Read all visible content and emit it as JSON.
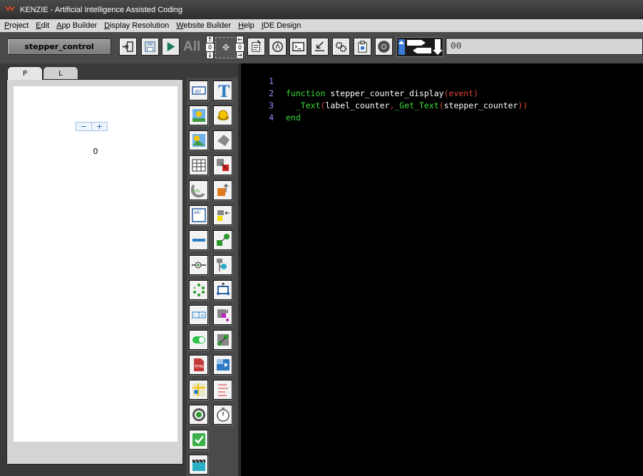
{
  "window": {
    "title": "KENZIE - Artificial Intelligence Assisted Coding"
  },
  "menu": [
    "Project",
    "Edit",
    "App Builder",
    "Display Resolution",
    "Website Builder",
    "Help",
    "IDE Design"
  ],
  "toolbar": {
    "project_name": "stepper_control",
    "all_label": "All",
    "offset_x": "0",
    "offset_y": "0",
    "zoom_field": "00",
    "icons": [
      "export-icon",
      "save-icon",
      "run-icon",
      "new-file-icon",
      "function-icon",
      "terminal-icon",
      "import-icon",
      "settings-icon",
      "clipboard-icon",
      "speaker-icon"
    ]
  },
  "device_tabs": [
    "P",
    "L"
  ],
  "preview": {
    "stepper_minus": "−",
    "stepper_plus": "+",
    "counter_value": "0"
  },
  "palette": {
    "items": [
      "textbox-icon",
      "label-text-icon",
      "image-icon",
      "button-icon",
      "image-button-icon",
      "shape-icon",
      "grid-icon",
      "layer-icon",
      "progress-icon",
      "move-icon",
      "textarea-icon",
      "align-icon",
      "slider-icon",
      "connect-icon",
      "switch-icon",
      "tree-icon",
      "spinner-icon",
      "resize-icon",
      "stepper-icon",
      "pivot-icon",
      "toggle-icon",
      "rotate-icon",
      "html-icon",
      "video-icon",
      "map-icon",
      "list-icon",
      "radio-icon",
      "timer-icon",
      "checkbox-icon",
      "clapper-icon"
    ]
  },
  "editor": {
    "lines": [
      {
        "num": "1",
        "kw": "function",
        "fn": " stepper_counter_display",
        "p1": "(",
        "arg": "event",
        "p2": ")"
      },
      {
        "num": "2",
        "indent": "  ",
        "api1": "_Text",
        "p1": "(",
        "t1": "label_counter",
        "c": ",",
        "api2": "_Get_Text",
        "p2": "(",
        "t2": "stepper_counter",
        "p3": "))"
      },
      {
        "num": "3",
        "kw": "end"
      },
      {
        "num": "4"
      }
    ]
  },
  "colors": {
    "keyword": "#3ddc3d",
    "paren": "#e0463b",
    "line_number": "#8c8cff",
    "editor_bg": "#000000"
  }
}
